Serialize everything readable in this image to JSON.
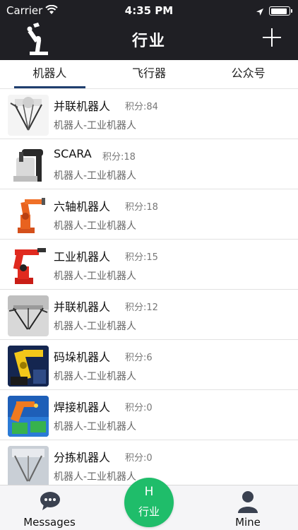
{
  "status_bar": {
    "carrier": "Carrier",
    "time": "4:35 PM",
    "battery_level": 0.95
  },
  "nav": {
    "title": "行业",
    "logo_icon": "robot-arm-icon",
    "add_icon": "plus-icon"
  },
  "tabs": [
    {
      "label": "机器人",
      "active": true
    },
    {
      "label": "飞行器",
      "active": false
    },
    {
      "label": "公众号",
      "active": false
    }
  ],
  "list": [
    {
      "title": "并联机器人",
      "score": "积分:84",
      "category": "机器人-工业机器人",
      "thumb": "delta-robot-white"
    },
    {
      "title": "SCARA",
      "score": "积分:18",
      "category": "机器人-工业机器人",
      "thumb": "scara-robot"
    },
    {
      "title": "六轴机器人",
      "score": "积分:18",
      "category": "机器人-工业机器人",
      "thumb": "six-axis-robot-orange"
    },
    {
      "title": "工业机器人",
      "score": "积分:15",
      "category": "机器人-工业机器人",
      "thumb": "industrial-robot-red"
    },
    {
      "title": "并联机器人",
      "score": "积分:12",
      "category": "机器人-工业机器人",
      "thumb": "delta-robot-gray"
    },
    {
      "title": "码垛机器人",
      "score": "积分:6",
      "category": "机器人-工业机器人",
      "thumb": "palletizing-robot"
    },
    {
      "title": "焊接机器人",
      "score": "积分:0",
      "category": "机器人-工业机器人",
      "thumb": "welding-robot"
    },
    {
      "title": "分拣机器人",
      "score": "积分:0",
      "category": "机器人-工业机器人",
      "thumb": "sorting-robot"
    }
  ],
  "bottom_bar": {
    "messages_label": "Messages",
    "center_letter": "H",
    "center_label": "行业",
    "mine_label": "Mine",
    "accent": "#1fbd6a"
  }
}
